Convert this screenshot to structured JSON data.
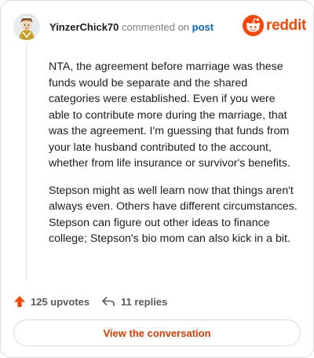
{
  "header": {
    "username": "YinzerChick70",
    "action_text": "commented on",
    "post_link": "post",
    "brand": "reddit"
  },
  "comment": {
    "paragraphs": [
      "NTA, the agreement before marriage was these funds would be separate and the shared categories were established. Even if you were able to contribute more during the marriage, that was the agreement. I'm guessing that funds from your late husband contributed to the account, whether from life insurance or survivor's benefits.",
      "Stepson might as well learn now that things aren't always even. Others have different circumstances. Stepson can figure out other ideas to finance college; Stepson's bio mom can also kick in a bit."
    ]
  },
  "footer": {
    "upvotes": "125 upvotes",
    "replies": "11 replies",
    "cta": "View the conversation"
  },
  "colors": {
    "accent": "#ff4500",
    "cta_text": "#d93a00",
    "link": "#0a66c2"
  },
  "icons": {
    "upvote": "upvote-arrow-icon",
    "reply": "reply-arrow-icon",
    "brand": "reddit-snoo-icon"
  }
}
